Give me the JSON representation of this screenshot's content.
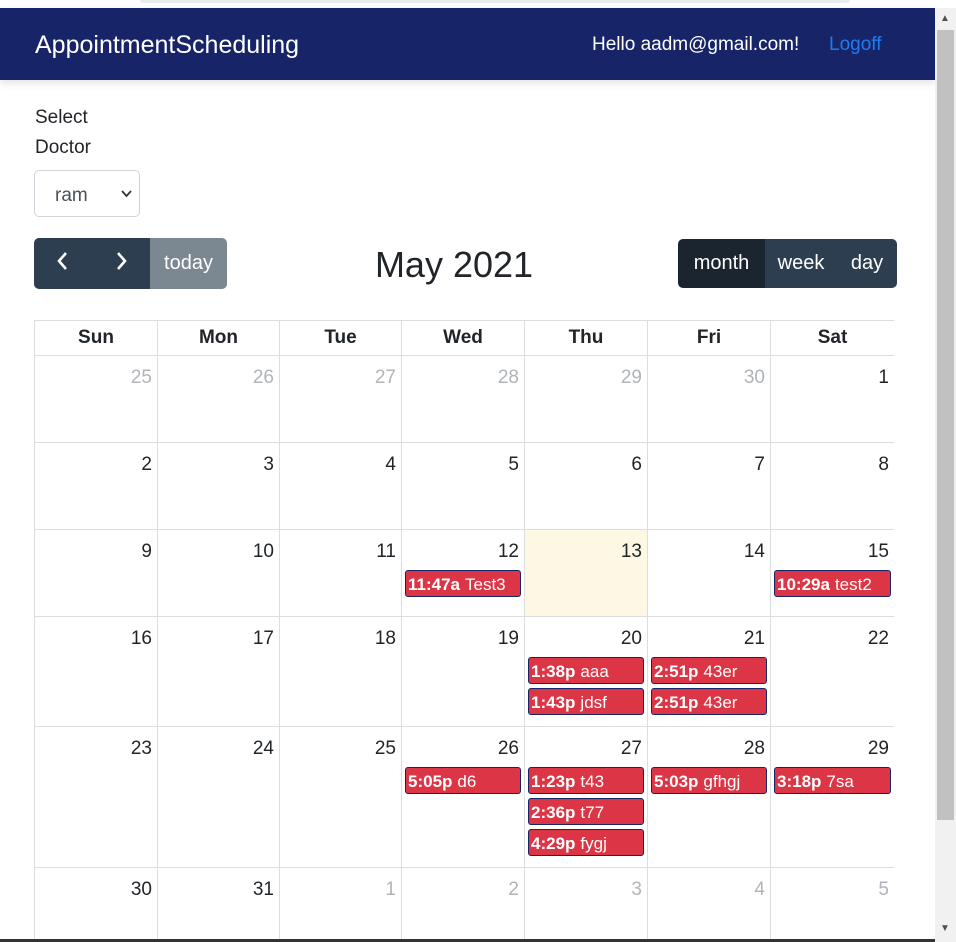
{
  "navbar": {
    "brand": "AppointmentScheduling",
    "greeting": "Hello aadm@gmail.com!",
    "logoff_label": "Logoff"
  },
  "filter": {
    "label": "Select Doctor",
    "selected": "ram"
  },
  "toolbar": {
    "prev_icon": "chevron-left-icon",
    "next_icon": "chevron-right-icon",
    "today_label": "today",
    "title": "May 2021",
    "views": [
      "month",
      "week",
      "day"
    ],
    "active_view": "month"
  },
  "calendar": {
    "headers": [
      "Sun",
      "Mon",
      "Tue",
      "Wed",
      "Thu",
      "Fri",
      "Sat"
    ],
    "weeks": [
      [
        {
          "d": "25",
          "o": true
        },
        {
          "d": "26",
          "o": true
        },
        {
          "d": "27",
          "o": true
        },
        {
          "d": "28",
          "o": true
        },
        {
          "d": "29",
          "o": true
        },
        {
          "d": "30",
          "o": true
        },
        {
          "d": "1"
        }
      ],
      [
        {
          "d": "2"
        },
        {
          "d": "3"
        },
        {
          "d": "4"
        },
        {
          "d": "5"
        },
        {
          "d": "6"
        },
        {
          "d": "7"
        },
        {
          "d": "8"
        }
      ],
      [
        {
          "d": "9"
        },
        {
          "d": "10"
        },
        {
          "d": "11"
        },
        {
          "d": "12",
          "ev": [
            {
              "t": "11:47a",
              "n": "Test3"
            }
          ]
        },
        {
          "d": "13",
          "today": true
        },
        {
          "d": "14"
        },
        {
          "d": "15",
          "ev": [
            {
              "t": "10:29a",
              "n": "test2"
            }
          ]
        }
      ],
      [
        {
          "d": "16"
        },
        {
          "d": "17"
        },
        {
          "d": "18"
        },
        {
          "d": "19"
        },
        {
          "d": "20",
          "ev": [
            {
              "t": "1:38p",
              "n": "aaa"
            },
            {
              "t": "1:43p",
              "n": "jdsf"
            }
          ]
        },
        {
          "d": "21",
          "ev": [
            {
              "t": "2:51p",
              "n": "43er"
            },
            {
              "t": "2:51p",
              "n": "43er"
            }
          ]
        },
        {
          "d": "22"
        }
      ],
      [
        {
          "d": "23"
        },
        {
          "d": "24"
        },
        {
          "d": "25"
        },
        {
          "d": "26",
          "ev": [
            {
              "t": "5:05p",
              "n": "d6"
            }
          ]
        },
        {
          "d": "27",
          "ev": [
            {
              "t": "1:23p",
              "n": "t43"
            },
            {
              "t": "2:36p",
              "n": "t77"
            },
            {
              "t": "4:29p",
              "n": "fygj"
            }
          ]
        },
        {
          "d": "28",
          "ev": [
            {
              "t": "5:03p",
              "n": "gfhgj"
            }
          ]
        },
        {
          "d": "29",
          "ev": [
            {
              "t": "3:18p",
              "n": "7sa"
            }
          ]
        }
      ],
      [
        {
          "d": "30"
        },
        {
          "d": "31"
        },
        {
          "d": "1",
          "o": true
        },
        {
          "d": "2",
          "o": true
        },
        {
          "d": "3",
          "o": true
        },
        {
          "d": "4",
          "o": true
        },
        {
          "d": "5",
          "o": true
        }
      ]
    ]
  },
  "colors": {
    "navbar": "#172568",
    "event": "#dc3545",
    "event_border": "#172568",
    "today_bg": "#fcf8e3",
    "link": "#1e7bf2"
  }
}
